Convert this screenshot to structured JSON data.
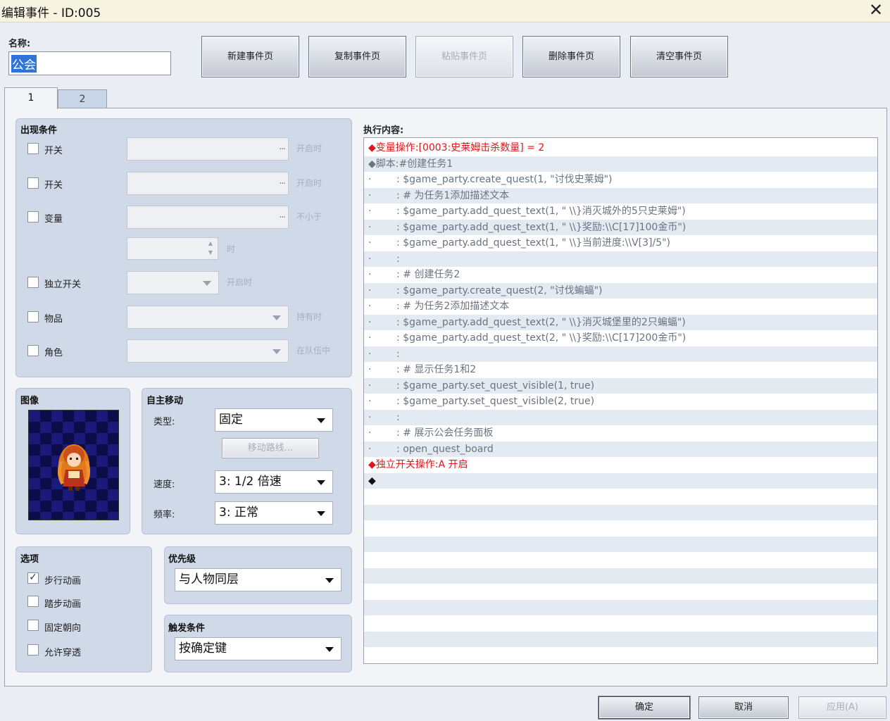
{
  "window": {
    "title": "编辑事件 - ID:005",
    "close_glyph": "✕"
  },
  "name": {
    "label": "名称:",
    "value": "公会"
  },
  "toolbar": {
    "new_page": "新建事件页",
    "copy_page": "复制事件页",
    "paste_page": "粘贴事件页",
    "delete_page": "删除事件页",
    "clear_page": "清空事件页"
  },
  "tabs": [
    {
      "label": "1"
    },
    {
      "label": "2"
    }
  ],
  "conditions": {
    "title": "出现条件",
    "switch1": {
      "label": "开关",
      "hint": "开启时",
      "dots": "...",
      "checked": false
    },
    "switch2": {
      "label": "开关",
      "hint": "开启时",
      "dots": "...",
      "checked": false
    },
    "variable": {
      "label": "变量",
      "hint": "不小于",
      "dots": "...",
      "checked": false
    },
    "variable_unit": "时",
    "self_switch": {
      "label": "独立开关",
      "hint": "开启时",
      "checked": false
    },
    "item": {
      "label": "物品",
      "hint": "持有时",
      "checked": false
    },
    "actor": {
      "label": "角色",
      "hint": "在队伍中",
      "checked": false
    }
  },
  "image": {
    "title": "图像"
  },
  "autonomous": {
    "title": "自主移动",
    "type_label": "类型:",
    "type_value": "固定",
    "route_button": "移动路线...",
    "speed_label": "速度:",
    "speed_value": "3: 1/2 倍速",
    "freq_label": "频率:",
    "freq_value": "3: 正常"
  },
  "options": {
    "title": "选项",
    "items": [
      {
        "label": "步行动画",
        "checked": true
      },
      {
        "label": "踏步动画",
        "checked": false
      },
      {
        "label": "固定朝向",
        "checked": false
      },
      {
        "label": "允许穿透",
        "checked": false
      }
    ]
  },
  "priority": {
    "title": "优先级",
    "value": "与人物同层"
  },
  "trigger": {
    "title": "触发条件",
    "value": "按确定键"
  },
  "contents": {
    "label": "执行内容:",
    "lines": [
      {
        "text": "◆变量操作:[0003:史莱姆击杀数量] = 2",
        "style": "red"
      },
      {
        "text": "◆脚本:#创建任务1",
        "style": "gray"
      },
      {
        "text": "·        : $game_party.create_quest(1, \"讨伐史莱姆\")",
        "style": "gray"
      },
      {
        "text": "·        : # 为任务1添加描述文本",
        "style": "gray"
      },
      {
        "text": "·        : $game_party.add_quest_text(1, \" \\\\}消灭城外的5只史莱姆\")",
        "style": "gray"
      },
      {
        "text": "·        : $game_party.add_quest_text(1, \" \\\\}奖励:\\\\C[17]100金币\")",
        "style": "gray"
      },
      {
        "text": "·        : $game_party.add_quest_text(1, \" \\\\}当前进度:\\\\V[3]/5\")",
        "style": "gray"
      },
      {
        "text": "·        :",
        "style": "gray"
      },
      {
        "text": "·        : # 创建任务2",
        "style": "gray"
      },
      {
        "text": "·        : $game_party.create_quest(2, \"讨伐蝙蝠\")",
        "style": "gray"
      },
      {
        "text": "·        : # 为任务2添加描述文本",
        "style": "gray"
      },
      {
        "text": "·        : $game_party.add_quest_text(2, \" \\\\}消灭城堡里的2只蝙蝠\")",
        "style": "gray"
      },
      {
        "text": "·        : $game_party.add_quest_text(2, \" \\\\}奖励:\\\\C[17]200金币\")",
        "style": "gray"
      },
      {
        "text": "·        :",
        "style": "gray"
      },
      {
        "text": "·        : # 显示任务1和2",
        "style": "gray"
      },
      {
        "text": "·        : $game_party.set_quest_visible(1, true)",
        "style": "gray"
      },
      {
        "text": "·        : $game_party.set_quest_visible(2, true)",
        "style": "gray"
      },
      {
        "text": "·        :",
        "style": "gray"
      },
      {
        "text": "·        : # 展示公会任务面板",
        "style": "gray"
      },
      {
        "text": "·        : open_quest_board",
        "style": "gray"
      },
      {
        "text": "◆独立开关操作:A 开启",
        "style": "red"
      },
      {
        "text": "◆",
        "style": "black"
      }
    ]
  },
  "footer": {
    "ok": "确定",
    "cancel": "取消",
    "apply": "应用(A)"
  }
}
